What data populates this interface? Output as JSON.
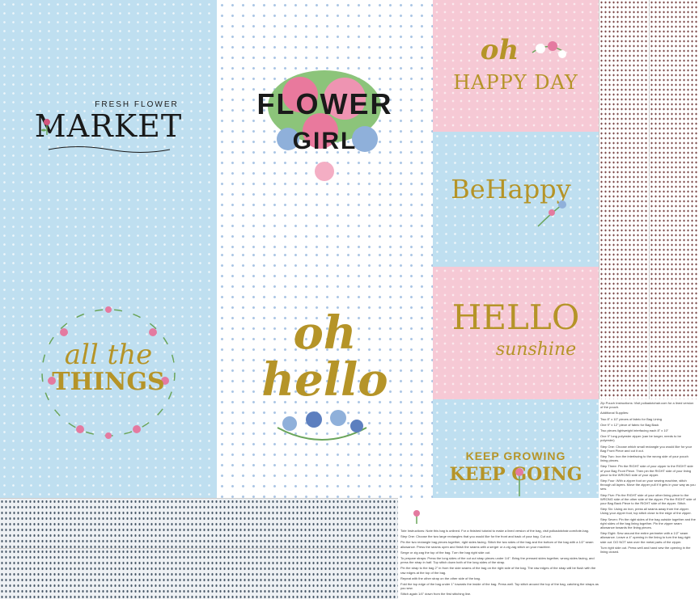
{
  "panels": {
    "market": {
      "small": "FRESH FLOWER",
      "big": "MARKET"
    },
    "flower_girl": {
      "line1": "FLOWER",
      "line2": "GIRL"
    },
    "all_things": {
      "line1": "all the",
      "line2": "THINGS"
    },
    "oh_hello": {
      "line1": "oh",
      "line2": "hello"
    },
    "happy_day": {
      "line1": "oh",
      "line2": "HAPPY DAY"
    },
    "be_happy": {
      "text": "BeHappy"
    },
    "hello_sunshine": {
      "line1": "HELLO",
      "line2": "sunshine"
    },
    "keep_growing": {
      "line1": "KEEP GROWING",
      "line2": "KEEP GOING"
    }
  },
  "instructions": {
    "title": "Tote Instructions:",
    "lines": [
      "Tote Instructions: Note this bag is unlined. For a finished tutorial to make a lined version of the bag, visit polkadotchair.com/tote-bag.",
      "Step One: Choose the two large rectangles that you would like for the front and back of your bag. Cut out.",
      "Pin the two rectangle bag pieces together, right sides facing. Stitch the two sides of the bag and the bottom of the bag with a 1/2\" seam allowance. Press the seams open and finish the seams with a serger or a zig zag stitch on your machine.",
      "Serge or zig zag the top of the bag. Turn the bag right side out.",
      "To prepare straps: Press the long sides of the cut out strap pieces under 1/4\". Bring the pressed sides together, wrong sides facing, and press the strap in half. Top stitch down both of the long sides of the strap.",
      "Pin the strap to the bag 2\" in from the side seams of the bag on the right side of the bag. The raw edges of the strap will be flush with the raw edges at the top of the bag.",
      "Repeat with the other strap on the other side of the bag.",
      "Fold the top edge of the bag under 1\" towards the inside of the bag. Press well. Top stitch around the top of the bag, catching the straps as you sew.",
      "Stitch again 1/4\" down from the first stitching line."
    ],
    "side_lines": [
      "Zip Pouch Instructions: Visit polkadotchair.com for a lined version of the pouch.",
      "Additional Supplies:",
      "Two 8\" x 10\" pieces of fabric for Bag Lining",
      "One 9\" x 12\" piece of fabric for Bag Back",
      "Two pieces lightweight interfacing each 8\" x 10\"",
      "One 9\" long polyester zipper (can be longer, needs to be polyester)",
      "Step One: Choose which small rectangle you would like for your Bag Front Piece and cut it out.",
      "Step Two: Iron the interfacing to the wrong side of your pouch lining pieces.",
      "Step Three: Pin the RIGHT side of your zipper to the RIGHT side of your Bag Front Piece. Then pin the RIGHT side of your lining piece to the WRONG side of your zipper.",
      "Step Four: With a zipper foot on your sewing machine, stitch through all layers. Move the zipper pull if it gets in your way as you sew.",
      "Step Five: Pin the RIGHT side of your other lining piece to the WRONG side of the other side of the zipper. Pin the RIGHT side of your Bag Back Piece to the RIGHT side of the zipper. Stitch.",
      "Step Six: Using an iron, press all seams away from the zipper. Using your zipper foot, top stitch close to the edge of the zipper.",
      "Step Seven: Pin the right sides of the bag outside together and the right sides of the bag lining together. Pin the zipper seam allowance towards the lining pieces.",
      "Step Eight: Sew around the entire perimeter with a 1/2\" seam allowance. Leave a 4\" opening in the lining to turn the bag right side out. DO NOT sew over the metal parts of the zipper.",
      "Turn right side out. Press well and hand sew the opening in the lining closed."
    ]
  },
  "colors": {
    "blue": "#bfdff0",
    "pink": "#f6c9d5",
    "gold": "#b59428",
    "black": "#1a1a1a"
  }
}
